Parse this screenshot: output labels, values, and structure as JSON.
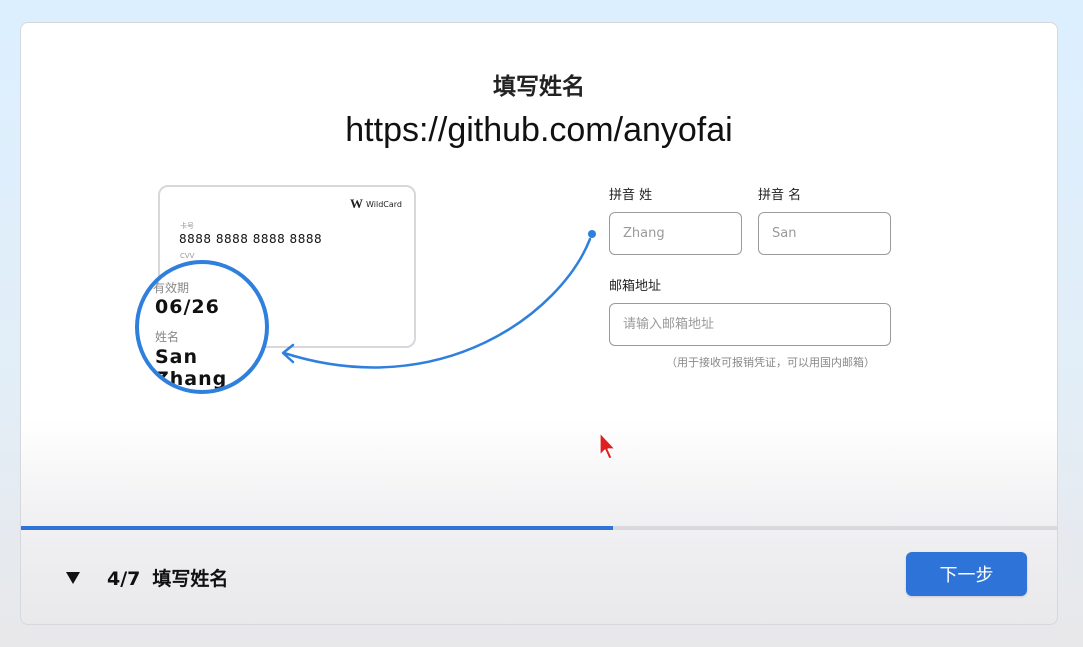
{
  "page": {
    "title": "填写姓名",
    "url": "https://github.com/anyofai"
  },
  "card": {
    "brand": "WildCard",
    "brand_mark": "W",
    "number_label": "卡号",
    "number": "8888 8888 8888 8888",
    "cvv_label": "CVV"
  },
  "magnifier": {
    "expiry_label": "有效期",
    "expiry_value": "06/26",
    "name_label": "姓名",
    "name_value": "San Zhang"
  },
  "form": {
    "last_name_label": "拼音 姓",
    "last_name_placeholder": "Zhang",
    "first_name_label": "拼音 名",
    "first_name_placeholder": "San",
    "email_label": "邮箱地址",
    "email_placeholder": "请输入邮箱地址",
    "email_hint": "（用于接收可报销凭证，可以用国内邮箱）"
  },
  "progress": {
    "step": "4/7",
    "step_name": "填写姓名",
    "fraction": 0.571
  },
  "buttons": {
    "next": "下一步"
  },
  "colors": {
    "accent": "#2e73d8",
    "arrow": "#2f7fdd",
    "cursor": "#e02020"
  },
  "icons": {
    "toggle": "triangle-down-icon",
    "cursor": "mouse-pointer-icon"
  }
}
